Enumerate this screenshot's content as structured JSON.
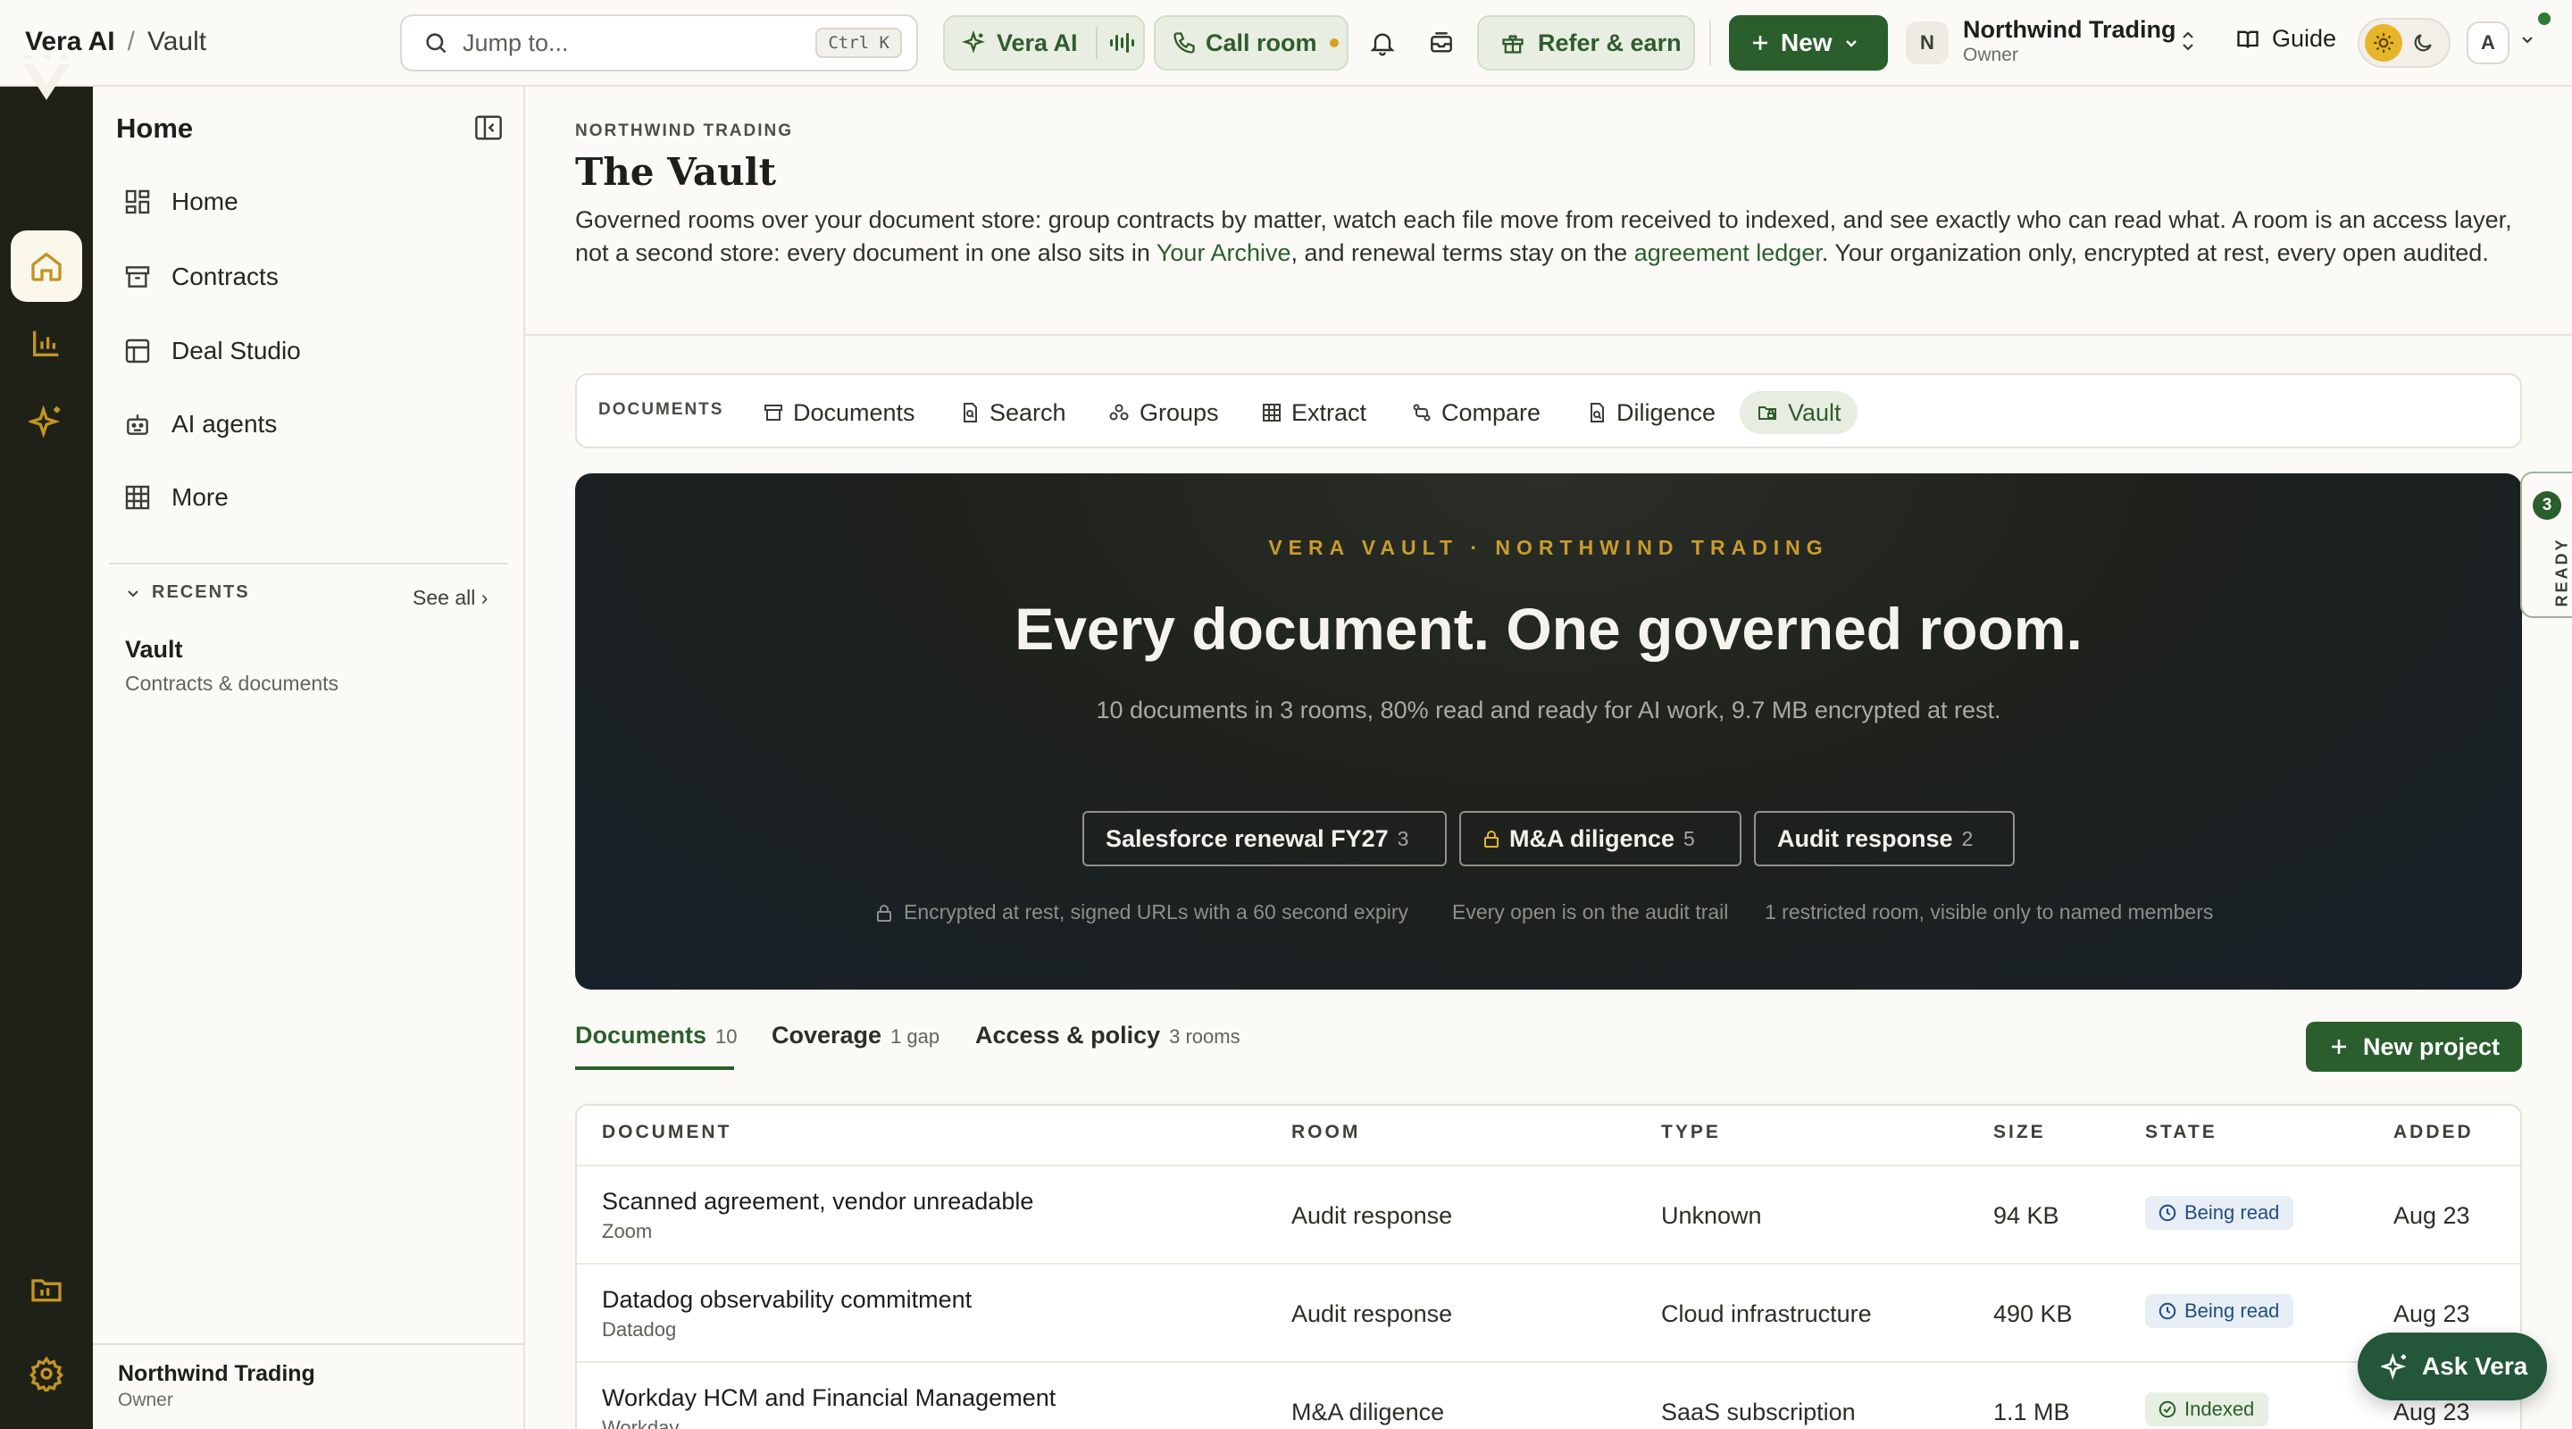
{
  "topbar": {
    "app_name": "Vera AI",
    "separator": "/",
    "page_crumb": "Vault",
    "search_placeholder": "Jump to...",
    "search_shortcut": "Ctrl K",
    "vera_ai_label": "Vera AI",
    "call_room_label": "Call room",
    "refer_label": "Refer & earn",
    "new_label": "New",
    "org_initial": "N",
    "org_name": "Northwind Trading",
    "org_role": "Owner",
    "guide_label": "Guide",
    "user_initial": "A"
  },
  "sidebar": {
    "title": "Home",
    "items": [
      {
        "label": "Home",
        "icon": "grid-icon"
      },
      {
        "label": "Contracts",
        "icon": "archive-box-icon"
      },
      {
        "label": "Deal Studio",
        "icon": "layout-icon"
      },
      {
        "label": "AI agents",
        "icon": "robot-icon"
      },
      {
        "label": "More",
        "icon": "table-grid-icon"
      }
    ],
    "recents_label": "RECENTS",
    "see_all_label": "See all ›",
    "recent": {
      "title": "Vault",
      "subtitle": "Contracts & documents"
    },
    "footer_org": "Northwind Trading",
    "footer_role": "Owner"
  },
  "page": {
    "eyebrow": "NORTHWIND TRADING",
    "title": "The Vault",
    "intro_1": "Governed rooms over your document store: group contracts by matter, watch each file move from received to indexed, and see exactly who can read what. A room is an access layer, not a second store: every document in one also sits in ",
    "intro_link_1": "Your Archive",
    "intro_2": ", and renewal terms stay on the ",
    "intro_link_2": "agreement ledger",
    "intro_3": ". Your organization only, encrypted at rest, every open audited."
  },
  "doc_tabs": {
    "label": "DOCUMENTS",
    "items": [
      "Documents",
      "Search",
      "Groups",
      "Extract",
      "Compare",
      "Diligence",
      "Vault"
    ],
    "active": "Vault"
  },
  "hero": {
    "eyebrow": "VERA VAULT · NORTHWIND TRADING",
    "title": "Every document. One governed room.",
    "subtitle": "10 documents in 3 rooms, 80% read and ready for AI work, 9.7 MB encrypted at rest.",
    "rooms": [
      {
        "name": "Salesforce renewal FY27",
        "count": "3",
        "locked": false
      },
      {
        "name": "M&A diligence",
        "count": "5",
        "locked": true
      },
      {
        "name": "Audit response",
        "count": "2",
        "locked": false
      }
    ],
    "facts": [
      "Encrypted at rest, signed URLs with a 60 second expiry",
      "Every open is on the audit trail",
      "1 restricted room, visible only to named members"
    ]
  },
  "ready_tab": {
    "count": "3",
    "label": "READY"
  },
  "section_tabs": [
    {
      "label": "Documents",
      "count": "10"
    },
    {
      "label": "Coverage",
      "count": "1 gap"
    },
    {
      "label": "Access & policy",
      "count": "3 rooms"
    }
  ],
  "new_project_label": "New project",
  "table": {
    "headers": [
      "DOCUMENT",
      "ROOM",
      "TYPE",
      "SIZE",
      "STATE",
      "ADDED"
    ],
    "rows": [
      {
        "name": "Scanned agreement, vendor unreadable",
        "vendor": "Zoom",
        "room": "Audit response",
        "type": "Unknown",
        "size": "94 KB",
        "state": "Being read",
        "added": "Aug 23"
      },
      {
        "name": "Datadog observability commitment",
        "vendor": "Datadog",
        "room": "Audit response",
        "type": "Cloud infrastructure",
        "size": "490 KB",
        "state": "Being read",
        "added": "Aug 23"
      },
      {
        "name": "Workday HCM and Financial Management",
        "vendor": "Workday",
        "room": "M&A diligence",
        "type": "SaaS subscription",
        "size": "1.1 MB",
        "state": "Indexed",
        "added": "Aug 23"
      }
    ]
  },
  "ask_vera_label": "Ask Vera",
  "colors": {
    "brand_green": "#2a5e2c",
    "accent_gold": "#c99b2c",
    "rail": "#1f2119"
  }
}
